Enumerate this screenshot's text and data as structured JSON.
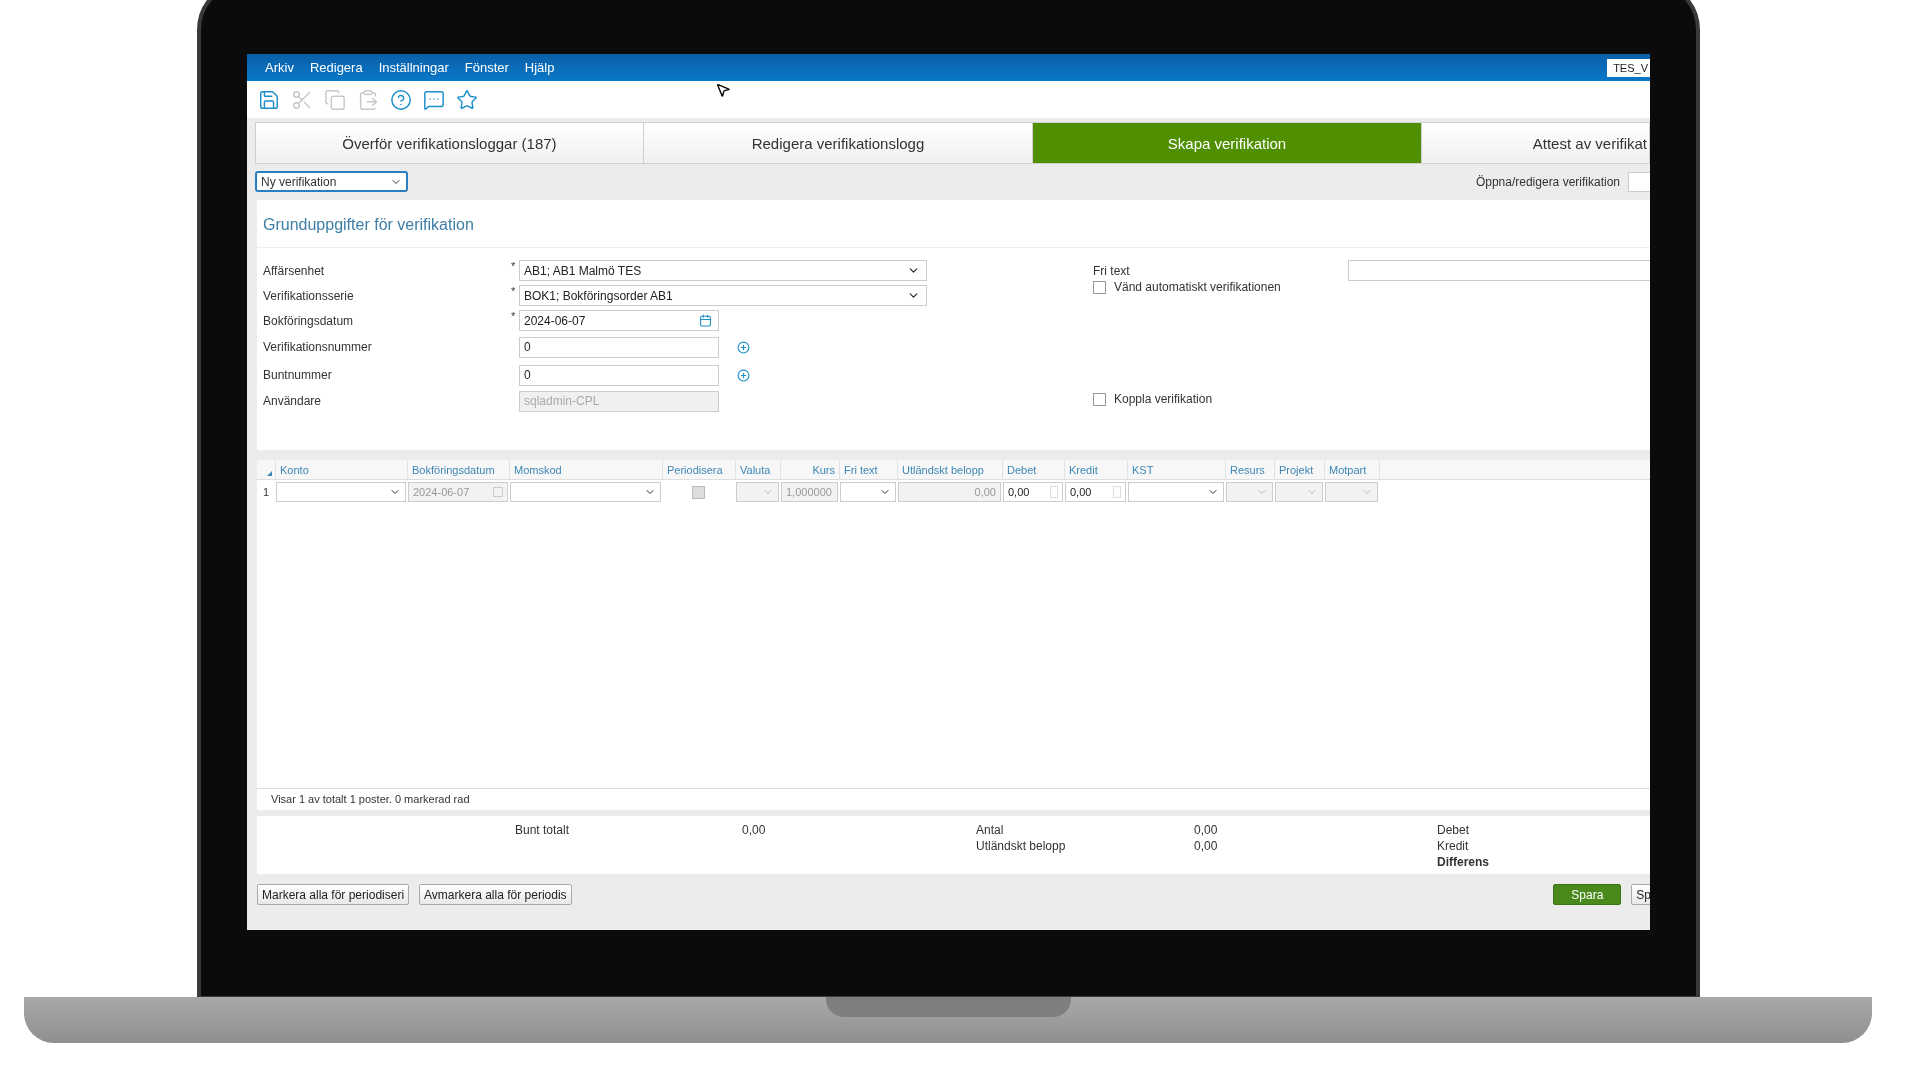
{
  "menu": [
    "Arkiv",
    "Redigera",
    "Inställningar",
    "Fönster",
    "Hjälp"
  ],
  "user_box": "TES_V",
  "toolbar": [
    {
      "disabled": false
    },
    {
      "disabled": true
    },
    {
      "disabled": true
    },
    {
      "disabled": true
    },
    {
      "disabled": false
    },
    {
      "disabled": false
    },
    {
      "disabled": false
    }
  ],
  "tabs": [
    {
      "label": "Överför verifikationsloggar (187)",
      "selected": false
    },
    {
      "label": "Redigera verifikationslogg",
      "selected": false
    },
    {
      "label": "Skapa verifikation",
      "selected": true
    },
    {
      "label": "Attest av verifikat",
      "selected": false
    }
  ],
  "mode_select": "Ny verifikation",
  "open_label": "Öppna/redigera verifikation",
  "section_title": "Grunduppgifter för verifikation",
  "fields": [
    {
      "label": "Affärsenhet",
      "required_mark": "*",
      "kind": "select",
      "value": "AB1; AB1 Malmö TES"
    },
    {
      "label": "Verifikationsserie",
      "required_mark": "*",
      "kind": "select",
      "value": "BOK1; Bokföringsorder AB1"
    },
    {
      "label": "Bokföringsdatum",
      "required_mark": "*",
      "kind": "date",
      "value": "2024-06-07"
    },
    {
      "label": "Verifikationsnummer",
      "kind": "number",
      "value": "0"
    },
    {
      "label": "Buntnummer",
      "kind": "number",
      "value": "0"
    },
    {
      "label": "Användare",
      "kind": "readonly",
      "value": "sqladmin-CPL"
    }
  ],
  "free_text_label": "Fri text",
  "checkboxes": [
    {
      "label": "Vänd automatiskt verifikationen",
      "checked": false
    },
    {
      "label": "Koppla verifikation",
      "checked": false
    }
  ],
  "table": {
    "columns": [
      "Konto",
      "Bokföringsdatum",
      "Momskod",
      "Periodisera",
      "Valuta",
      "Kurs",
      "Fri text",
      "Utländskt belopp",
      "Debet",
      "Kredit",
      "KST",
      "Resurs",
      "Projekt",
      "Motpart"
    ],
    "rows": [
      {
        "number": "1",
        "cells": [
          {
            "kind": "select",
            "disabled": false
          },
          {
            "kind": "date",
            "disabled": true,
            "value": "2024-06-07"
          },
          {
            "kind": "select",
            "disabled": false
          },
          {
            "kind": "checkbox",
            "disabled": true,
            "checked": false
          },
          {
            "kind": "select",
            "disabled": true
          },
          {
            "kind": "text",
            "disabled": true,
            "value": "1,000000"
          },
          {
            "kind": "select",
            "disabled": false
          },
          {
            "kind": "amount",
            "disabled": true,
            "value": "0,00"
          },
          {
            "kind": "spin",
            "disabled": false,
            "value": "0,00"
          },
          {
            "kind": "spin",
            "disabled": false,
            "value": "0,00"
          },
          {
            "kind": "select",
            "disabled": false
          },
          {
            "kind": "select",
            "disabled": true
          },
          {
            "kind": "select",
            "disabled": true
          },
          {
            "kind": "select",
            "disabled": true
          }
        ]
      }
    ]
  },
  "status": "Visar 1 av totalt 1 poster. 0 markerad rad",
  "totals": {
    "bunt_label": "Bunt totalt",
    "bunt_value": "0,00",
    "antal_label": "Antal",
    "antal_value": "0,00",
    "foreign_label": "Utländskt belopp",
    "foreign_value": "0,00",
    "debet_label": "Debet",
    "kredit_label": "Kredit",
    "diff_label": "Differens"
  },
  "buttons": [
    "Markera alla för periodiseri",
    "Avmarkera alla för periodis"
  ],
  "save_button": "Spara",
  "cut_button": "Sp"
}
